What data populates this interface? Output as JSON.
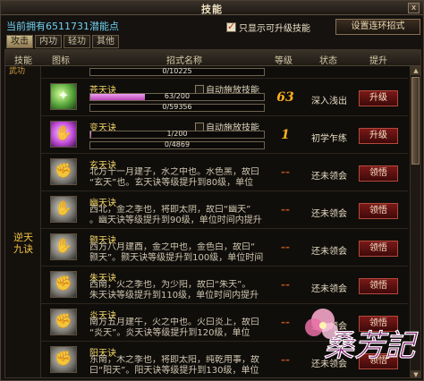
{
  "window": {
    "title": "技能",
    "close_label": "x"
  },
  "potential_points": "当前拥有6511731潜能点",
  "filter_checkbox_label": "只显示可升级技能",
  "loop_button_label": "设置连环招式",
  "tabs": [
    "攻击",
    "内功",
    "轻功",
    "其他"
  ],
  "headers": [
    "技能",
    "图标",
    "招式名称",
    "等级",
    "状态",
    "提升"
  ],
  "group": {
    "top_label": "武功",
    "label": "逆天九诀"
  },
  "partial_row": {
    "exp_text": "0/10225"
  },
  "skills": [
    {
      "name": "苍天诀",
      "auto_cast": "自动施放技能",
      "icon": "green",
      "icon_glyph": "✦",
      "bar1_text": "63/200",
      "bar1_fill": 0.315,
      "bar2_text": "0/59356",
      "level": "63",
      "state": "深入浅出",
      "action": "升级"
    },
    {
      "name": "变天诀",
      "auto_cast": "自动施放技能",
      "icon": "purple",
      "icon_glyph": "✋",
      "bar1_text": "1/200",
      "bar1_fill": 0.005,
      "bar2_text": "0/4869",
      "level": "1",
      "state": "初学乍练",
      "action": "升级"
    },
    {
      "name": "玄天诀",
      "desc1": "北方十一月建子，水之中也。水色黑，故曰",
      "desc2": "“玄天”也。玄天诀等级提升到80级，单位",
      "icon": "gray",
      "icon_glyph": "✊",
      "level": "--",
      "state": "还未领会",
      "action": "领悟"
    },
    {
      "name": "幽天诀",
      "desc1": "西北，金之季也，将即太阴，故曰“幽天”",
      "desc2": "。幽天诀等级提升到90级，单位时间内提升",
      "icon": "gray",
      "icon_glyph": "✋",
      "level": "--",
      "state": "还未领会",
      "action": "领悟"
    },
    {
      "name": "颢天诀",
      "desc1": "西方八月建酉，金之中也，金色白，故曰“",
      "desc2": "颢天”。颢天诀等级提升到100级，单位时间",
      "icon": "gray",
      "icon_glyph": "✋",
      "level": "--",
      "state": "还未领会",
      "action": "领悟"
    },
    {
      "name": "朱天诀",
      "desc1": "西南，火之季也，为少阳，故曰“朱天”。",
      "desc2": "朱天诀等级提升到110级，单位时间内提升",
      "icon": "gray",
      "icon_glyph": "✊",
      "level": "--",
      "state": "还未领会",
      "action": "领悟"
    },
    {
      "name": "炎天诀",
      "desc1": "南方五月建午，火之中也。火曰炎上，故曰",
      "desc2": "“炎天”。炎天诀等级提升到120级，单位",
      "icon": "gray",
      "icon_glyph": "✊",
      "level": "--",
      "state": "还未领会",
      "action": "领悟"
    },
    {
      "name": "阳天诀",
      "desc1": "东南，木之季也，将即太阳，纯乾用事，故",
      "desc2": "曰“阳天”。阳天诀等级提升到130级，单位",
      "icon": "gray",
      "icon_glyph": "✊",
      "level": "--",
      "state": "还未领会",
      "action": "领悟"
    }
  ],
  "logo_text": "桑芳記",
  "colors": {
    "accent_gold": "#f2d56a",
    "cyan": "#6fd0f0",
    "button_red": "#7a1818"
  }
}
